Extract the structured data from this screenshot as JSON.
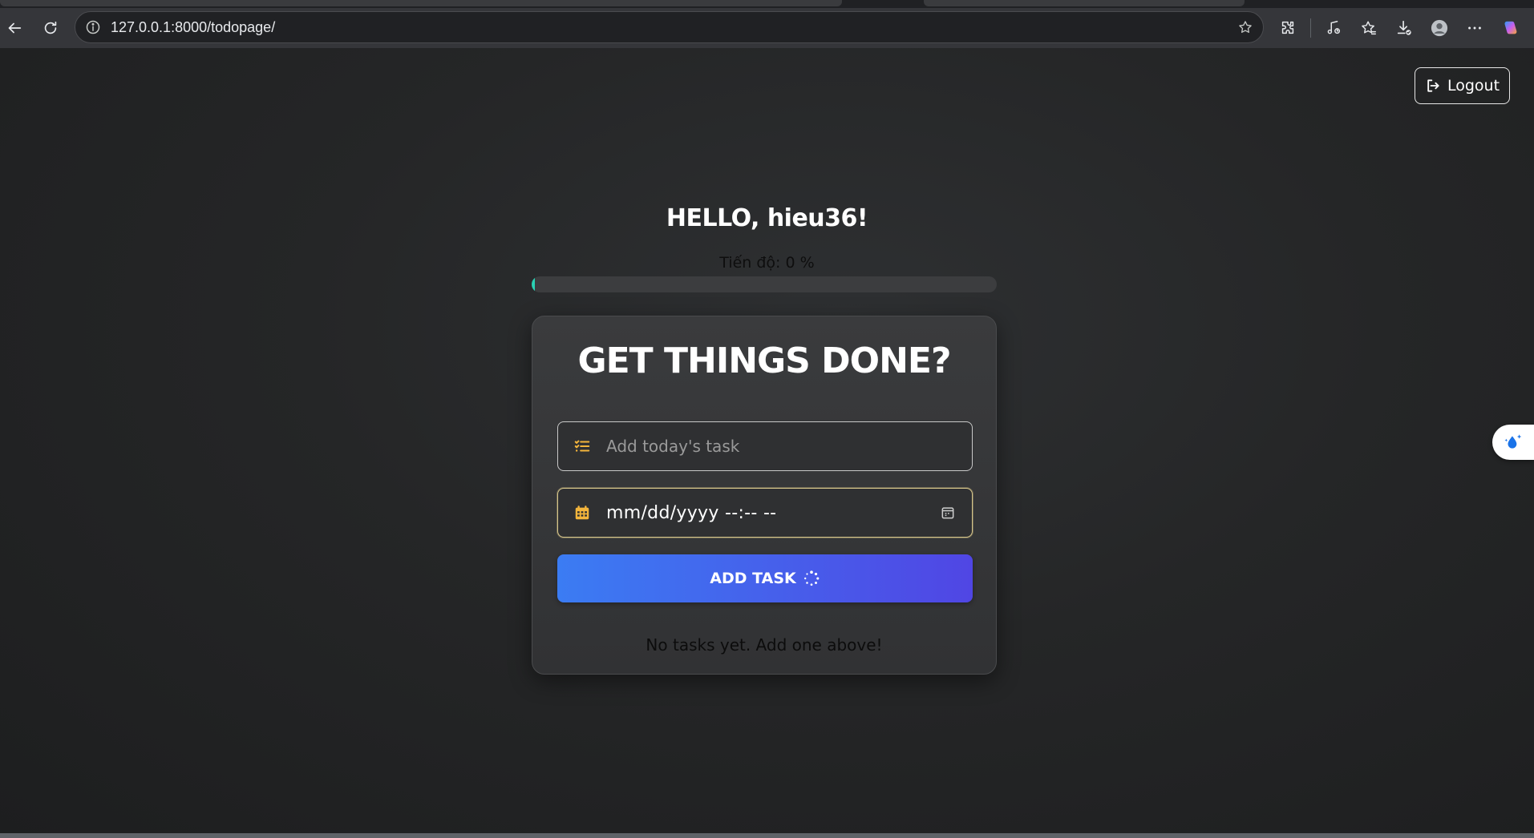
{
  "browser": {
    "url": "127.0.0.1:8000/todopage/",
    "icons": {
      "back": "back-arrow-icon",
      "reload": "reload-icon",
      "site_info": "info-icon",
      "favorite": "star-icon",
      "extensions": "puzzle-icon",
      "media": "media-icon",
      "favorites": "favorites-icon",
      "downloads": "download-icon",
      "profile": "profile-icon",
      "more": "more-icon",
      "copilot": "copilot-icon"
    }
  },
  "header": {
    "logout_label": "Logout"
  },
  "greeting": "HELLO, hieu36!",
  "progress": {
    "label": "Tiến độ: 0 %",
    "value": 0,
    "color": "#2ad1b3"
  },
  "card": {
    "title": "GET THINGS DONE?",
    "task_input": {
      "placeholder": "Add today's task",
      "value": ""
    },
    "date_input": {
      "value": "mm/dd/yyyy --:-- --"
    },
    "add_button_label": "ADD TASK",
    "empty_message": "No tasks yet. Add one above!"
  },
  "colors": {
    "accent_gradient_start": "#3b7cf3",
    "accent_gradient_end": "#5046e4",
    "icon_accent": "#f3b53c"
  }
}
